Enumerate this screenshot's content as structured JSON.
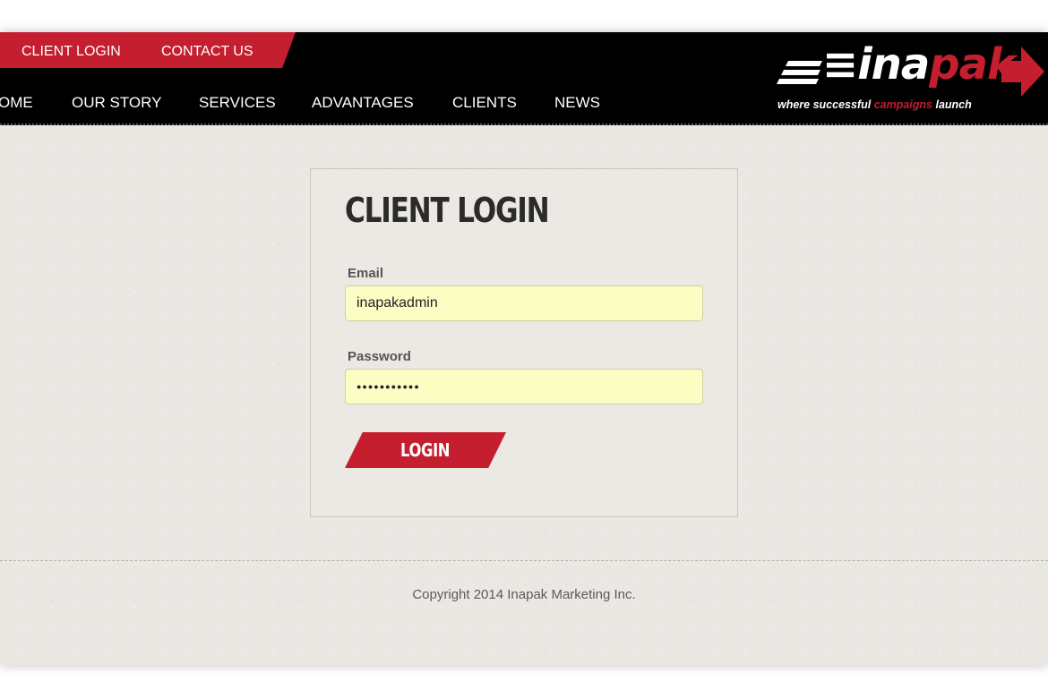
{
  "top_links": {
    "client_login": "CLIENT LOGIN",
    "contact_us": "CONTACT US"
  },
  "nav": {
    "home": "OME",
    "our_story": "OUR STORY",
    "services": "SERVICES",
    "advantages": "ADVANTAGES",
    "clients": "CLIENTS",
    "news": "NEWS"
  },
  "logo": {
    "word_white": "≡ina",
    "word_red": "pak",
    "arrow": "➡",
    "tagline_start": "where successful ",
    "tagline_red": "campaigns",
    "tagline_end": " launch"
  },
  "login": {
    "title": "CLIENT LOGIN",
    "email_label": "Email",
    "email_value": "inapakadmin",
    "password_label": "Password",
    "password_value": "●●●●●●●●●●●",
    "button_label": "LOGIN"
  },
  "footer": {
    "copyright": "Copyright 2014 Inapak Marketing Inc."
  },
  "colors": {
    "brand_red": "#c41e2f",
    "header_black": "#000000",
    "input_yellow": "#fbfdc3",
    "paper": "#ebe8e4"
  }
}
